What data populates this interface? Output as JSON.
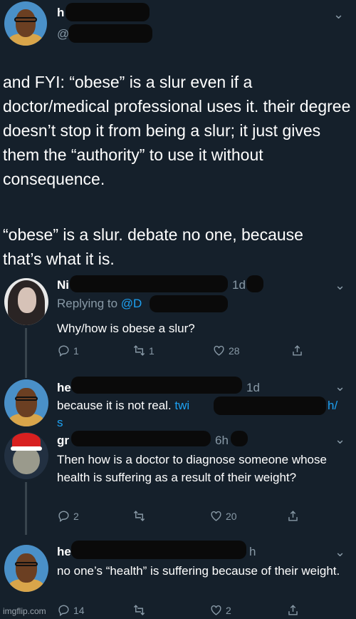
{
  "main_tweet": {
    "handle_fragment": "@",
    "paragraph1": "and FYI: “obese” is a slur even if a doctor/medical professional uses it. their degree doesn’t stop it from being a slur; it just gives them the “authority” to use it without consequence.",
    "paragraph2": "“obese” is a slur. debate no one, because that’s what it is."
  },
  "reply1": {
    "name_fragment": "Ni",
    "time": "1d",
    "replying_prefix": "Replying to",
    "replying_handle": "@D",
    "text": "Why/how is obese a slur?",
    "stats": {
      "replies": "1",
      "retweets": "1",
      "likes": "28"
    }
  },
  "reply2": {
    "name_fragment": "he",
    "time": "1d",
    "text": "because it is not real.",
    "link_fragment": "twi",
    "link_tail": "h/",
    "link_continuation": "s"
  },
  "reply3": {
    "name_fragment": "gr",
    "time": "6h",
    "text": "Then how is a doctor to diagnose someone whose health is suffering as a result of their weight?",
    "stats": {
      "replies": "2",
      "retweets": "",
      "likes": "20"
    }
  },
  "reply4": {
    "name_fragment": "he",
    "time": "h",
    "text": "no one’s “health” is suffering because of their weight.",
    "stats": {
      "replies": "14",
      "retweets": "",
      "likes": "2"
    }
  },
  "watermark": "imgflip.com",
  "colors": {
    "background": "#15202b",
    "secondary_text": "#8899a6",
    "link": "#1da1f2",
    "thread_line": "#38444d"
  }
}
